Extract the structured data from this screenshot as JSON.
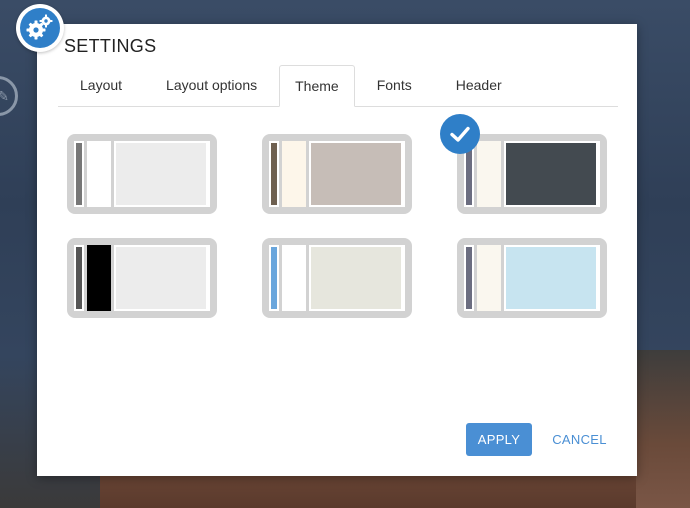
{
  "dialog": {
    "title": "SETTINGS"
  },
  "tabs": [
    {
      "label": "Layout",
      "active": false
    },
    {
      "label": "Layout options",
      "active": false
    },
    {
      "label": "Theme",
      "active": true
    },
    {
      "label": "Fonts",
      "active": false
    },
    {
      "label": "Header",
      "active": false
    }
  ],
  "themes": [
    {
      "sidebar": "#777777",
      "panel": "#ffffff",
      "content": "#ececec",
      "selected": false
    },
    {
      "sidebar": "#6e6050",
      "panel": "#fdf6ea",
      "content": "#c6bdb7",
      "selected": false
    },
    {
      "sidebar": "#6b6d80",
      "panel": "#faf7ef",
      "content": "#434a50",
      "selected": true
    },
    {
      "sidebar": "#555555",
      "panel": "#000000",
      "content": "#ececec",
      "selected": false
    },
    {
      "sidebar": "#6aa6dc",
      "panel": "#ffffff",
      "content": "#e6e6dd",
      "selected": false
    },
    {
      "sidebar": "#6b6d80",
      "panel": "#faf7ef",
      "content": "#c7e4f0",
      "selected": false
    }
  ],
  "actions": {
    "apply_label": "APPLY",
    "cancel_label": "CANCEL"
  },
  "icons": {
    "settings_badge": "gears-icon",
    "selected_theme": "checkmark-icon",
    "background_edit": "pencil-icon"
  },
  "colors": {
    "accent": "#2f7fc8",
    "apply_button": "#4a8fd4",
    "tile_frame": "#d2d2d2"
  }
}
